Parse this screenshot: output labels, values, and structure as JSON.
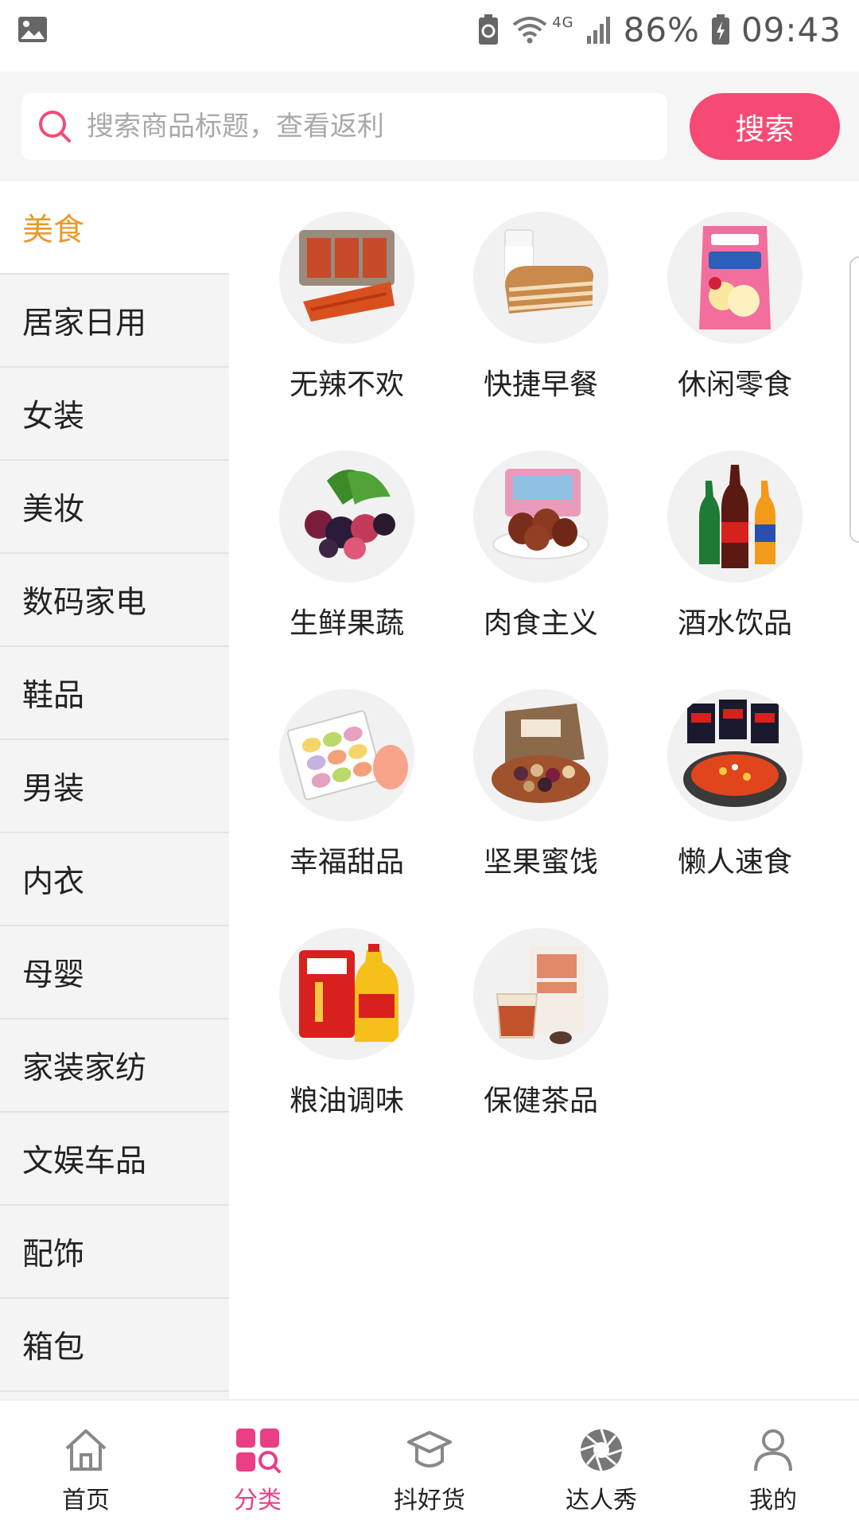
{
  "status_bar": {
    "battery": "86%",
    "time": "09:43",
    "network": "4G",
    "icons": [
      "gallery-icon",
      "battery-saver-icon",
      "wifi-icon",
      "signal-icon",
      "battery-icon"
    ]
  },
  "search": {
    "placeholder": "搜索商品标题，查看返利",
    "button_label": "搜索"
  },
  "colors": {
    "accent": "#f64a74",
    "active_category": "#e8992b",
    "active_nav": "#e93f86"
  },
  "sidebar": {
    "items": [
      {
        "label": "美食",
        "active": true
      },
      {
        "label": "居家日用"
      },
      {
        "label": "女装"
      },
      {
        "label": "美妆"
      },
      {
        "label": "数码家电"
      },
      {
        "label": "鞋品"
      },
      {
        "label": "男装"
      },
      {
        "label": "内衣"
      },
      {
        "label": "母婴"
      },
      {
        "label": "家装家纺"
      },
      {
        "label": "文娱车品"
      },
      {
        "label": "配饰"
      },
      {
        "label": "箱包"
      }
    ]
  },
  "categories": [
    {
      "label": "无辣不欢",
      "icon": "spicy-snacks-image"
    },
    {
      "label": "快捷早餐",
      "icon": "breakfast-image"
    },
    {
      "label": "休闲零食",
      "icon": "chips-image"
    },
    {
      "label": "生鲜果蔬",
      "icon": "berries-image"
    },
    {
      "label": "肉食主义",
      "icon": "meat-image"
    },
    {
      "label": "酒水饮品",
      "icon": "drinks-image"
    },
    {
      "label": "幸福甜品",
      "icon": "macarons-image"
    },
    {
      "label": "坚果蜜饯",
      "icon": "nuts-image"
    },
    {
      "label": "懒人速食",
      "icon": "instant-noodles-image"
    },
    {
      "label": "粮油调味",
      "icon": "rice-oil-image"
    },
    {
      "label": "保健茶品",
      "icon": "tea-image"
    }
  ],
  "bottom_nav": [
    {
      "label": "首页",
      "icon": "home-icon"
    },
    {
      "label": "分类",
      "icon": "category-icon",
      "active": true
    },
    {
      "label": "抖好货",
      "icon": "graduation-cap-icon"
    },
    {
      "label": "达人秀",
      "icon": "aperture-icon"
    },
    {
      "label": "我的",
      "icon": "user-icon"
    }
  ]
}
